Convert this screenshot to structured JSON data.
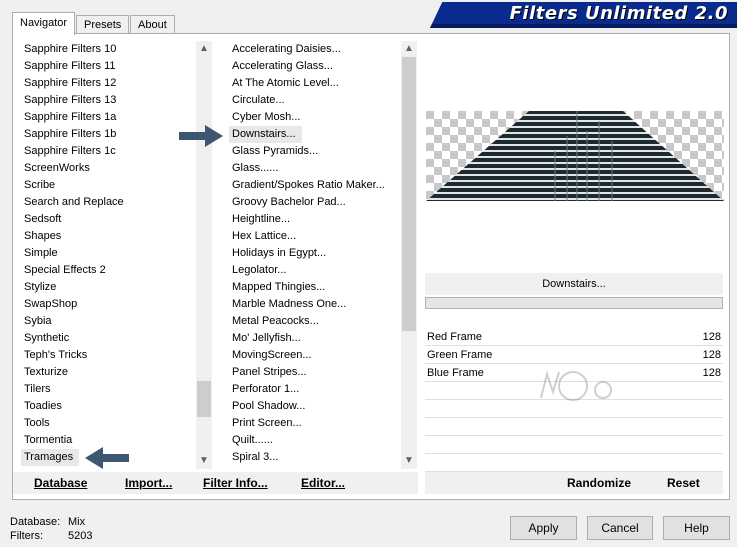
{
  "tabs": [
    {
      "label": "Navigator",
      "active": true
    },
    {
      "label": "Presets",
      "active": false
    },
    {
      "label": "About",
      "active": false
    }
  ],
  "banner": {
    "title": "Filters Unlimited 2.0"
  },
  "categories": [
    "Sapphire Filters 10",
    "Sapphire Filters 11",
    "Sapphire Filters 12",
    "Sapphire Filters 13",
    "Sapphire Filters 1a",
    "Sapphire Filters 1b",
    "Sapphire Filters 1c",
    "ScreenWorks",
    "Scribe",
    "Search and Replace",
    "Sedsoft",
    "Shapes",
    "Simple",
    "Special Effects 2",
    "Stylize",
    "SwapShop",
    "Sybia",
    "Synthetic",
    "Teph's Tricks",
    "Texturize",
    "Tilers",
    "Toadies",
    "Tools",
    "Tormentia",
    "Tramages"
  ],
  "selected_category": "Tramages",
  "filters": [
    "Accelerating Daisies...",
    "Accelerating Glass...",
    "At The Atomic Level...",
    "Circulate...",
    "Cyber Mosh...",
    "Downstairs...",
    "Glass Pyramids...",
    "Glass......",
    "Gradient/Spokes Ratio Maker...",
    "Groovy Bachelor Pad...",
    "Heightline...",
    "Hex Lattice...",
    "Holidays in Egypt...",
    "Legolator...",
    "Mapped Thingies...",
    "Marble Madness One...",
    "Metal Peacocks...",
    "Mo' Jellyfish...",
    "MovingScreen...",
    "Panel Stripes...",
    "Perforator 1...",
    "Pool Shadow...",
    "Print Screen...",
    "Quilt......",
    "Spiral 3..."
  ],
  "selected_filter": "Downstairs...",
  "list_buttons": {
    "database": "Database",
    "import": "Import...",
    "filter_info": "Filter Info...",
    "editor": "Editor..."
  },
  "preview": {
    "filter_name": "Downstairs..."
  },
  "params": [
    {
      "name": "Red Frame",
      "value": "128"
    },
    {
      "name": "Green Frame",
      "value": "128"
    },
    {
      "name": "Blue Frame",
      "value": "128"
    }
  ],
  "param_buttons": {
    "randomize": "Randomize",
    "reset": "Reset"
  },
  "status": {
    "database_label": "Database:",
    "database_value": "Mix",
    "filters_label": "Filters:",
    "filters_value": "5203"
  },
  "dialog_buttons": {
    "apply": "Apply",
    "cancel": "Cancel",
    "help": "Help"
  },
  "colors": {
    "banner": "#0a2a8e",
    "arrow": "#3f5673",
    "stripe_dark": "#1e2a30"
  }
}
